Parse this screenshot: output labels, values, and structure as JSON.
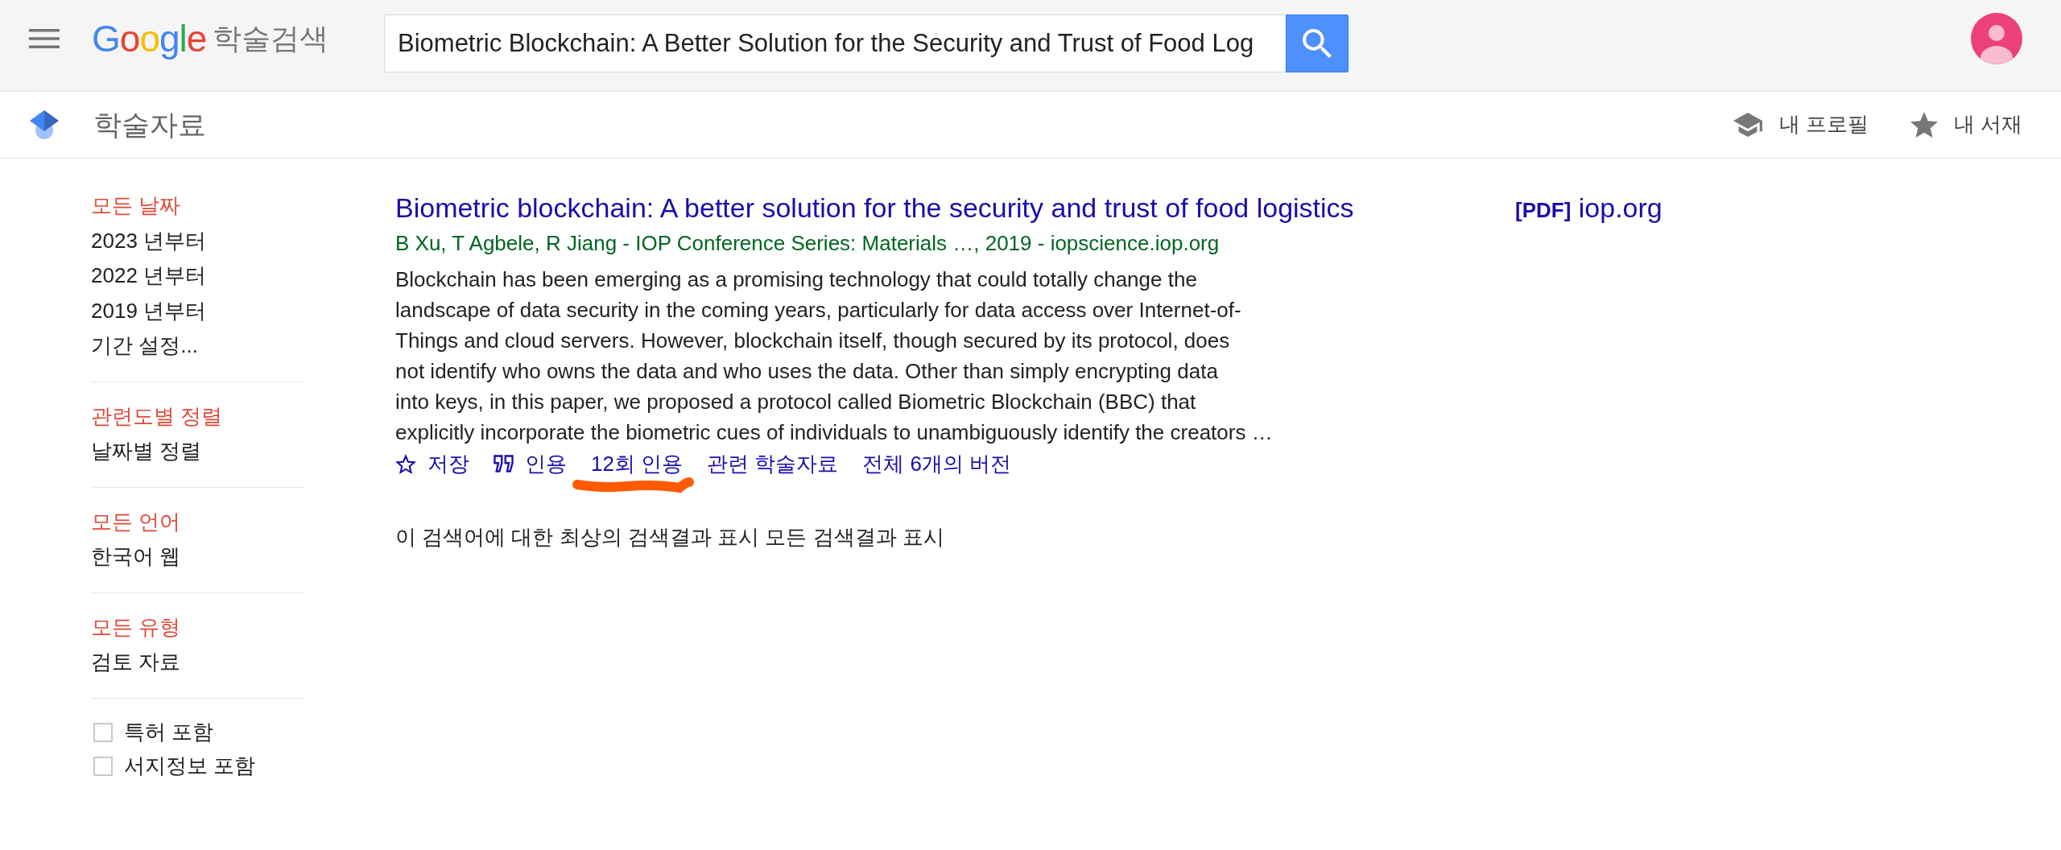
{
  "header": {
    "logo": {
      "brand": "Google",
      "product": "학술검색"
    },
    "search": {
      "value": "Biometric Blockchain: A Better Solution for the Security and Trust of Food Log"
    }
  },
  "subheader": {
    "title": "학술자료",
    "links": [
      {
        "kind": "profile",
        "label": "내 프로필"
      },
      {
        "kind": "library",
        "label": "내 서재"
      }
    ]
  },
  "sidebar": {
    "sections": [
      {
        "items": [
          {
            "label": "모든 날짜",
            "selected": true
          },
          {
            "label": "2023 년부터",
            "selected": false
          },
          {
            "label": "2022 년부터",
            "selected": false
          },
          {
            "label": "2019 년부터",
            "selected": false
          },
          {
            "label": "기간 설정...",
            "selected": false
          }
        ]
      },
      {
        "items": [
          {
            "label": "관련도별 정렬",
            "selected": true
          },
          {
            "label": "날짜별 정렬",
            "selected": false
          }
        ]
      },
      {
        "items": [
          {
            "label": "모든 언어",
            "selected": true
          },
          {
            "label": "한국어 웹",
            "selected": false
          }
        ]
      },
      {
        "items": [
          {
            "label": "모든 유형",
            "selected": true
          },
          {
            "label": "검토 자료",
            "selected": false
          }
        ]
      }
    ],
    "checkboxes": [
      {
        "label": "특허 포함",
        "checked": false
      },
      {
        "label": "서지정보 포함",
        "checked": false
      }
    ]
  },
  "results": [
    {
      "title": "Biometric blockchain: A better solution for the security and trust of food logistics",
      "byline": {
        "authors": "B Xu, T Agbele, ",
        "author_link": "R Jiang",
        "source": " - IOP Conference Series: Materials …, 2019 - iopscience.iop.org"
      },
      "snippet": "Blockchain has been emerging as a promising technology that could totally change the\nlandscape of data security in the coming years, particularly for data access over Internet-of-Things and cloud servers. However, blockchain itself, though secured by its protocol, does\nnot identify who owns the data and who uses the data. Other than simply encrypting data\ninto keys, in this paper, we proposed a protocol called Biometric Blockchain (BBC) that\nexplicitly incorporate the biometric cues of individuals to unambiguously identify the creators …",
      "actions": [
        {
          "kind": "save",
          "label": "저장",
          "annotated": false
        },
        {
          "kind": "cite",
          "label": "인용",
          "annotated": false
        },
        {
          "kind": "link",
          "label": "12회 인용",
          "annotated": true
        },
        {
          "kind": "link",
          "label": "관련 학술자료",
          "annotated": false
        },
        {
          "kind": "link",
          "label": "전체 6개의 버전",
          "annotated": false
        }
      ],
      "side_link": "**[PDF]** iop.org"
    }
  ],
  "notice": {
    "text": "이 검색어에 대한 최상의 검색결과 표시 ",
    "link": "모든 검색결과 표시"
  }
}
